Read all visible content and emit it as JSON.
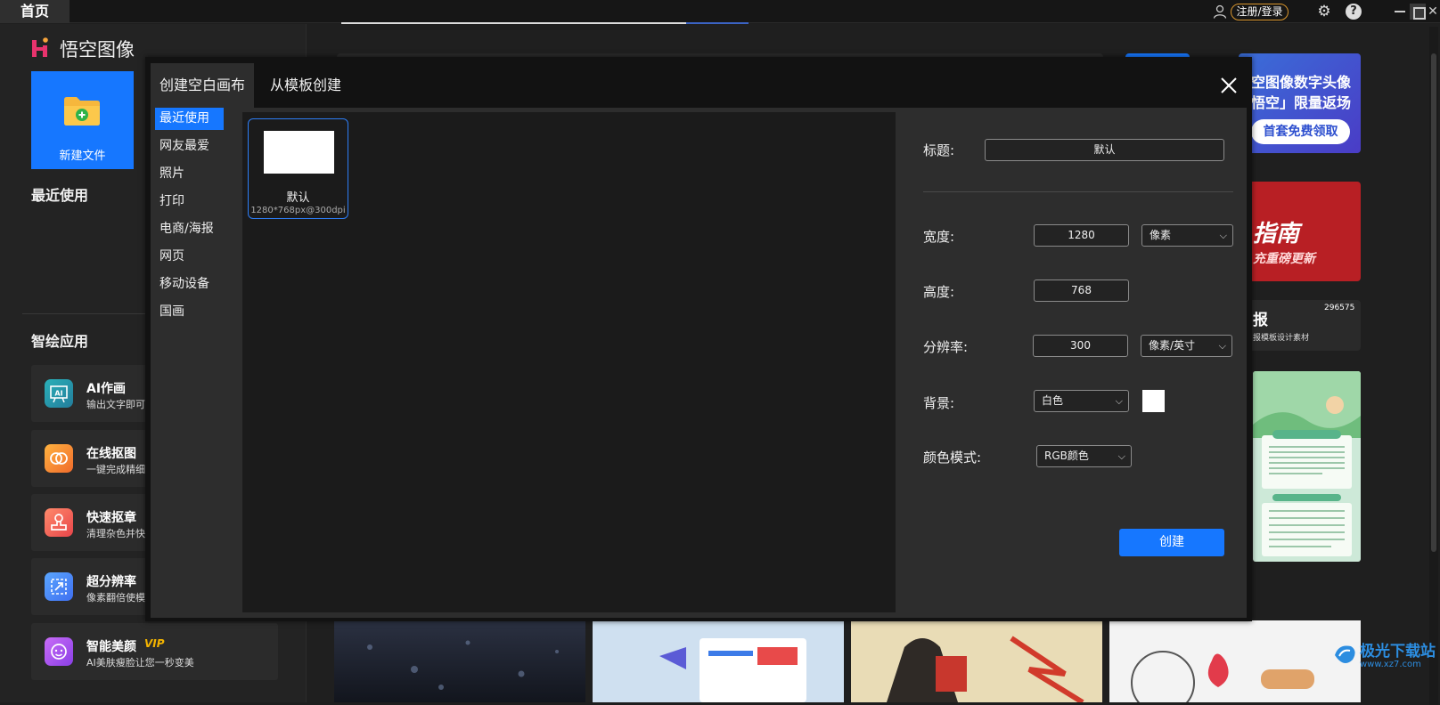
{
  "titlebar": {
    "home_tab": "首页",
    "login": "注册/登录"
  },
  "sidebar": {
    "app_name": "悟空图像",
    "new_file": "新建文件",
    "recent_title": "最近使用",
    "ai_title": "智绘应用",
    "apps": [
      {
        "name": "AI作画",
        "desc": "输出文字即可",
        "icon": "AI"
      },
      {
        "name": "在线抠图",
        "desc": "一键完成精细",
        "icon": "cutout"
      },
      {
        "name": "快速抠章",
        "desc": "清理杂色并快",
        "icon": "stamp"
      },
      {
        "name": "超分辨率",
        "desc": "像素翻倍使模",
        "icon": "upscale"
      },
      {
        "name": "智能美颜",
        "desc": "AI美肤瘦脸让您一秒变美",
        "icon": "beauty",
        "vip": "VIP"
      }
    ]
  },
  "banners": {
    "b1_line1": "空图像数字头像",
    "b1_line2": "悟空」限量返场",
    "b1_button": "首套免费领取",
    "b2_line1": "指南",
    "b2_line2": "充重磅更新",
    "b3_count": "296575",
    "b3_line1": "报",
    "b3_line2": "报模板设计素材"
  },
  "dialog": {
    "tabs": [
      "创建空白画布",
      "从模板创建"
    ],
    "categories": [
      "最近使用",
      "网友最爱",
      "照片",
      "打印",
      "电商/海报",
      "网页",
      "移动设备",
      "国画"
    ],
    "active_category": 0,
    "preset": {
      "name": "默认",
      "size": "1280*768px@300dpi"
    },
    "form": {
      "title_label": "标题:",
      "title_value": "默认",
      "width_label": "宽度:",
      "width_value": "1280",
      "width_unit": "像素",
      "height_label": "高度:",
      "height_value": "768",
      "resolution_label": "分辨率:",
      "resolution_value": "300",
      "resolution_unit": "像素/英寸",
      "background_label": "背景:",
      "background_value": "白色",
      "color_mode_label": "颜色模式:",
      "color_mode_value": "RGB颜色"
    },
    "create_button": "创建"
  },
  "watermark": {
    "line1": "极光下载站",
    "line2": "www.xz7.com"
  },
  "colors": {
    "accent": "#1677ff",
    "dialog_bg": "#121212",
    "panel_bg": "#2d2d2d"
  }
}
